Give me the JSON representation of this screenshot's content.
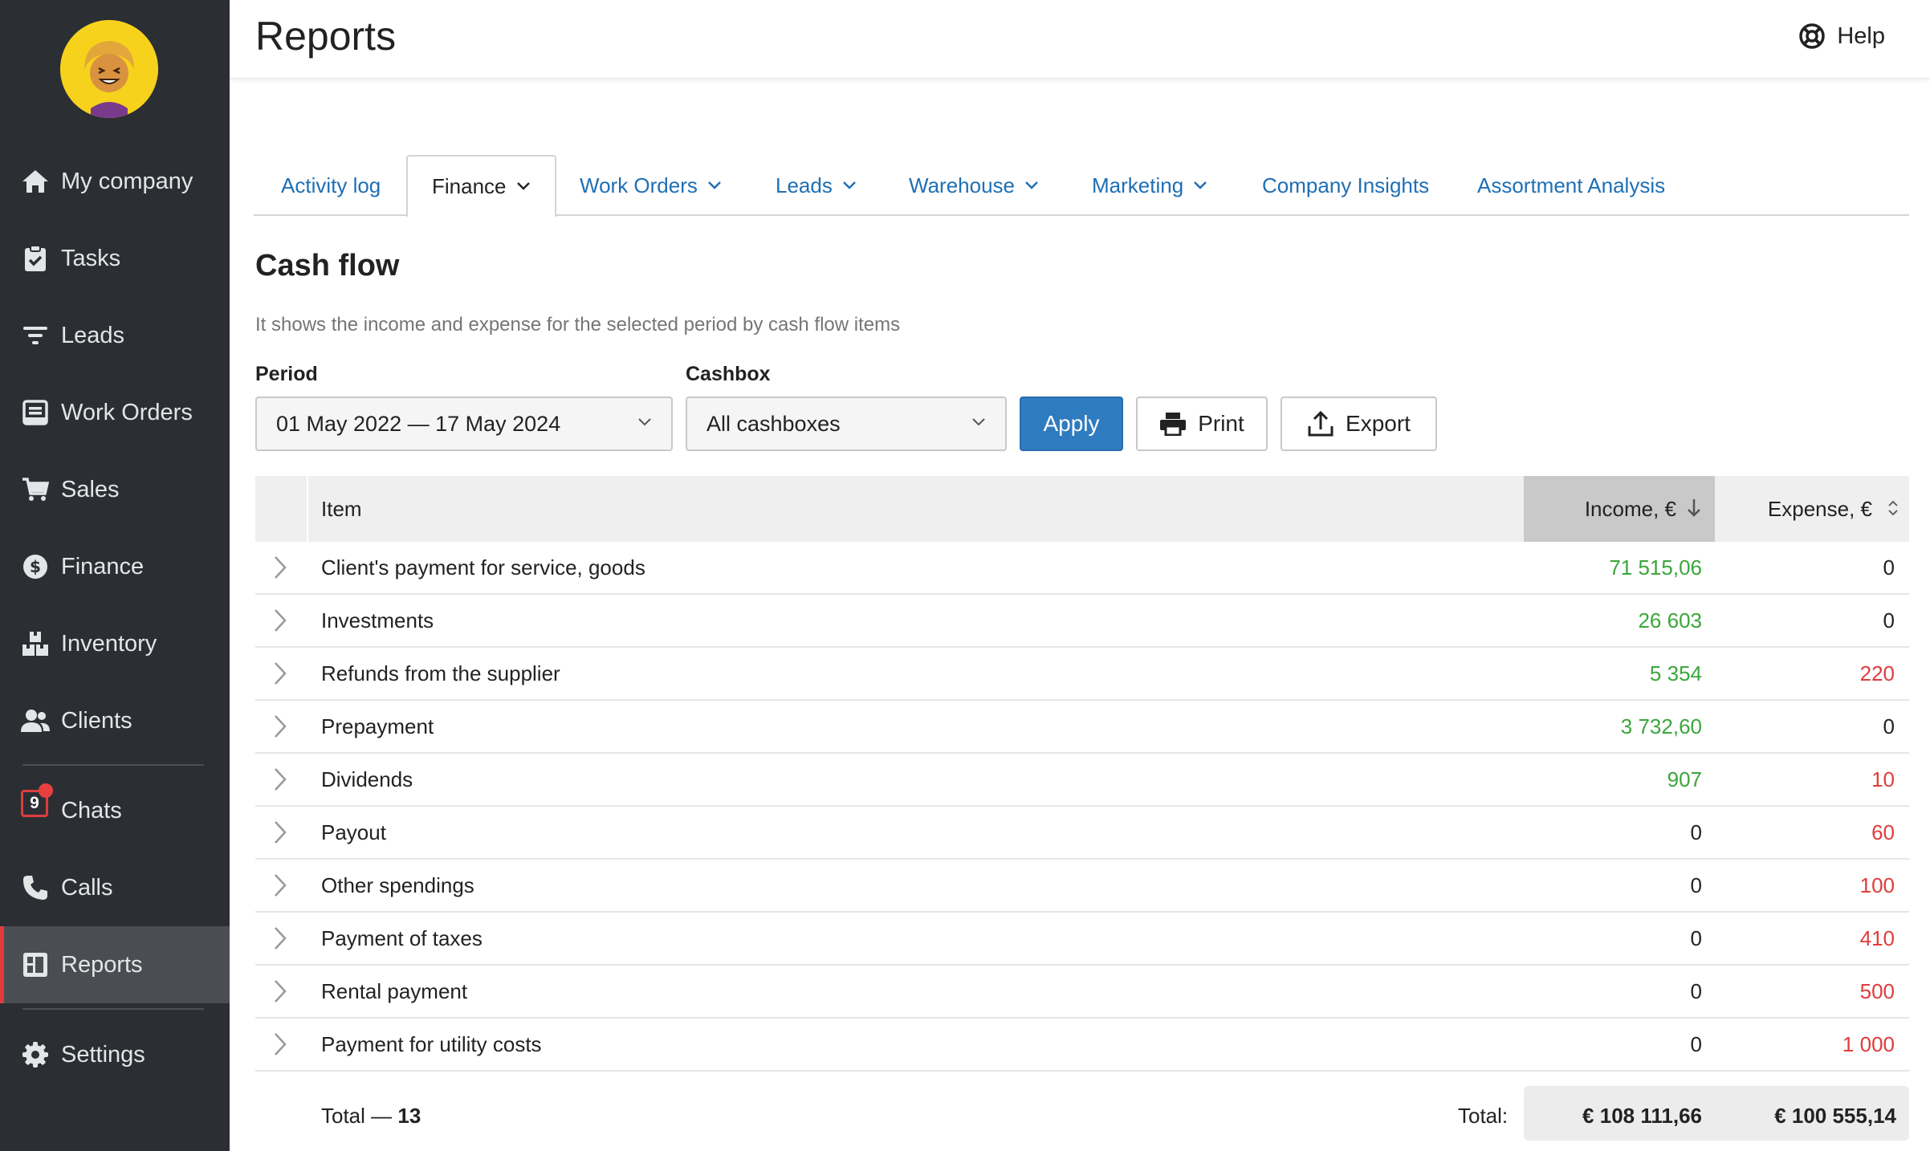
{
  "sidebar": {
    "items": [
      {
        "label": "My company",
        "icon": "home-icon"
      },
      {
        "label": "Tasks",
        "icon": "clipboard-check-icon"
      },
      {
        "label": "Leads",
        "icon": "funnel-icon"
      },
      {
        "label": "Work Orders",
        "icon": "work-order-icon"
      },
      {
        "label": "Sales",
        "icon": "cart-icon"
      },
      {
        "label": "Finance",
        "icon": "dollar-circle-icon"
      },
      {
        "label": "Inventory",
        "icon": "boxes-icon"
      },
      {
        "label": "Clients",
        "icon": "users-icon"
      },
      {
        "label": "Chats",
        "icon": "chat-icon",
        "badge": "9"
      },
      {
        "label": "Calls",
        "icon": "phone-icon"
      },
      {
        "label": "Reports",
        "icon": "reports-icon",
        "active": true
      },
      {
        "label": "Settings",
        "icon": "gear-icon"
      }
    ]
  },
  "header": {
    "title": "Reports",
    "help_label": "Help"
  },
  "tabs": [
    {
      "label": "Activity log",
      "dropdown": false
    },
    {
      "label": "Finance",
      "dropdown": true,
      "active": true
    },
    {
      "label": "Work Orders",
      "dropdown": true
    },
    {
      "label": "Leads",
      "dropdown": true
    },
    {
      "label": "Warehouse",
      "dropdown": true
    },
    {
      "label": "Marketing",
      "dropdown": true
    },
    {
      "label": "Company Insights",
      "dropdown": false
    },
    {
      "label": "Assortment Analysis",
      "dropdown": false
    }
  ],
  "report": {
    "title": "Cash flow",
    "description": "It shows the income and expense for the selected period by cash flow items"
  },
  "filters": {
    "period_label": "Period",
    "period_value": "01 May 2022 — 17 May 2024",
    "cashbox_label": "Cashbox",
    "cashbox_value": "All cashboxes",
    "apply_label": "Apply",
    "print_label": "Print",
    "export_label": "Export"
  },
  "table": {
    "columns": {
      "item": "Item",
      "income": "Income, €",
      "expense": "Expense, €"
    },
    "rows": [
      {
        "item": "Client's payment for service, goods",
        "income": "71 515,06",
        "expense": "0"
      },
      {
        "item": "Investments",
        "income": "26 603",
        "expense": "0"
      },
      {
        "item": "Refunds from the supplier",
        "income": "5 354",
        "expense": "220"
      },
      {
        "item": "Prepayment",
        "income": "3 732,60",
        "expense": "0"
      },
      {
        "item": "Dividends",
        "income": "907",
        "expense": "10"
      },
      {
        "item": "Payout",
        "income": "0",
        "expense": "60"
      },
      {
        "item": "Other spendings",
        "income": "0",
        "expense": "100"
      },
      {
        "item": "Payment of taxes",
        "income": "0",
        "expense": "410"
      },
      {
        "item": "Rental payment",
        "income": "0",
        "expense": "500"
      },
      {
        "item": "Payment for utility costs",
        "income": "0",
        "expense": "1 000"
      }
    ],
    "total_prefix": "Total — ",
    "total_count": "13",
    "total_label": "Total:",
    "total_income": "€ 108 111,66",
    "total_expense": "€ 100 555,14"
  },
  "colors": {
    "sidebar_bg": "#2b2f33",
    "accent_blue": "#2f7bbf",
    "income_green": "#3aa63a",
    "expense_red": "#e03c3c"
  }
}
